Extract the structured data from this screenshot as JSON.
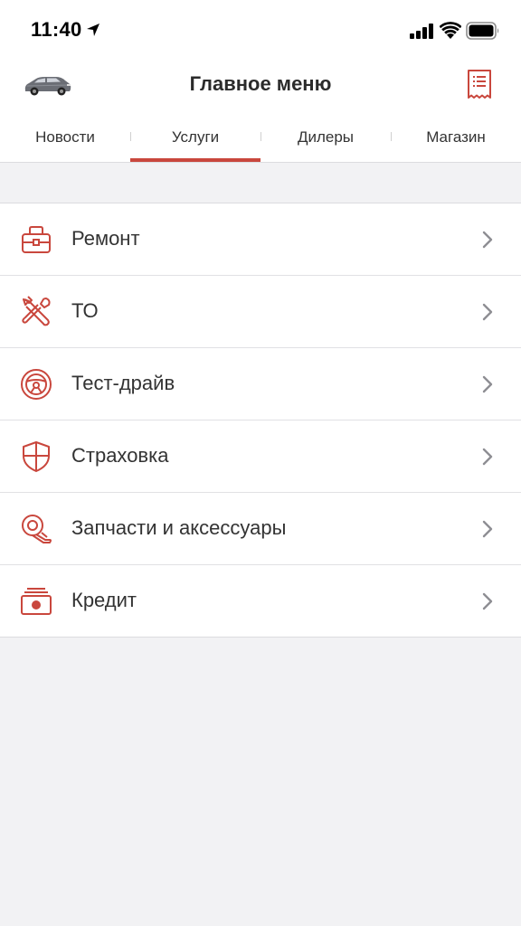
{
  "status_bar": {
    "time": "11:40",
    "icons": [
      "location-arrow-icon",
      "signal-icon",
      "wifi-icon",
      "battery-icon"
    ]
  },
  "header": {
    "title": "Главное меню",
    "left_icon": "car-icon",
    "right_icon": "receipt-icon"
  },
  "tabs": {
    "items": [
      {
        "label": "Новости",
        "active": false
      },
      {
        "label": "Услуги",
        "active": true
      },
      {
        "label": "Дилеры",
        "active": false
      },
      {
        "label": "Магазин",
        "active": false
      }
    ]
  },
  "menu": {
    "items": [
      {
        "label": "Ремонт",
        "icon": "toolbox-icon"
      },
      {
        "label": "ТО",
        "icon": "wrench-screwdriver-icon"
      },
      {
        "label": "Тест-драйв",
        "icon": "steering-wheel-icon"
      },
      {
        "label": "Страховка",
        "icon": "shield-icon"
      },
      {
        "label": "Запчасти и аксессуары",
        "icon": "parts-icon"
      },
      {
        "label": "Кредит",
        "icon": "cash-icon"
      }
    ]
  },
  "colors": {
    "accent": "#c9473d",
    "background": "#f2f2f4",
    "text": "#333333"
  }
}
